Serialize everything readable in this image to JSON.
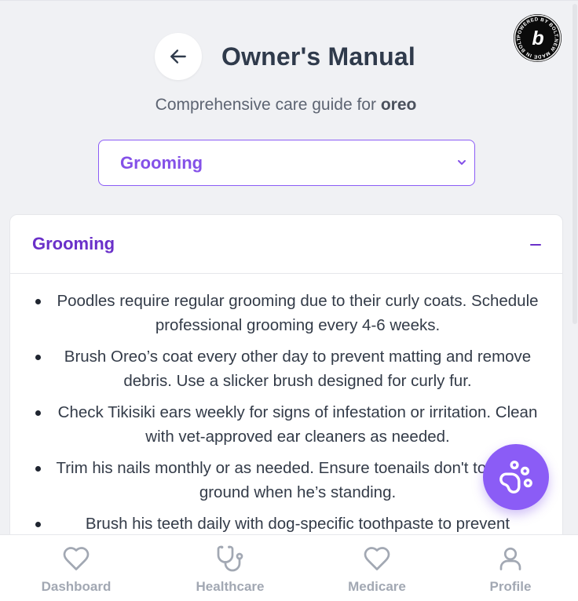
{
  "header": {
    "title": "Owner's Manual",
    "subtitle_prefix": "Comprehensive care guide for ",
    "pet_name": "oreo"
  },
  "badge": {
    "text": "POWERED BY BOLT.NEW MADE IN BOLT.NEW",
    "letter": "b"
  },
  "category_select": {
    "selected": "Grooming"
  },
  "section": {
    "title": "Grooming",
    "expanded": true,
    "tips": [
      "Poodles require regular grooming due to their curly coats. Schedule professional grooming every 4-6 weeks.",
      "Brush Oreo’s coat every other day to prevent matting and remove debris. Use a slicker brush designed for curly fur.",
      "Check Tikisiki ears weekly for signs of infestation or irritation. Clean with vet-approved ear cleaners as needed.",
      "Trim his nails monthly or as needed. Ensure toenails don't touch the ground when he’s standing.",
      "Brush his teeth daily with dog-specific toothpaste to prevent"
    ]
  },
  "fab": {
    "icon": "paw-icon"
  },
  "bottom_nav": {
    "items": [
      {
        "label": "Dashboard",
        "icon": "heart-icon"
      },
      {
        "label": "Healthcare",
        "icon": "stethoscope-icon"
      },
      {
        "label": "Medicare",
        "icon": "heart-icon"
      },
      {
        "label": "Profile",
        "icon": "user-icon"
      }
    ]
  },
  "colors": {
    "accent": "#8b5cf6",
    "section_title": "#6a30c9",
    "page_background": "#f0f1f4",
    "nav_inactive": "#a2a8b3"
  }
}
